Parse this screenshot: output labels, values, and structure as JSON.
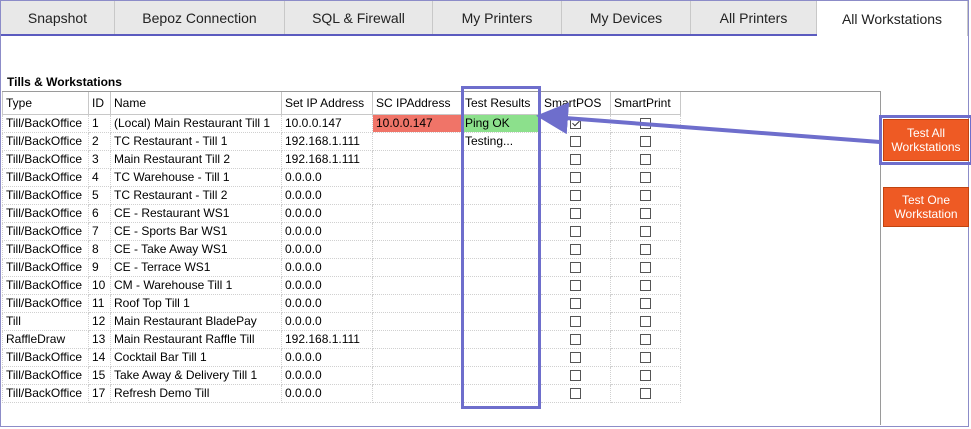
{
  "tabs": [
    {
      "label": "Snapshot",
      "width": 114
    },
    {
      "label": "Bepoz Connection",
      "width": 170
    },
    {
      "label": "SQL & Firewall",
      "width": 148
    },
    {
      "label": "My Printers",
      "width": 129
    },
    {
      "label": "My Devices",
      "width": 129
    },
    {
      "label": "All Printers",
      "width": 126
    },
    {
      "label": "All Workstations",
      "width": 151,
      "active": true
    }
  ],
  "section_title": "Tills & Workstations",
  "columns": [
    "Type",
    "ID",
    "Name",
    "Set IP Address",
    "SC IPAddress",
    "Test Results",
    "SmartPOS",
    "SmartPrint"
  ],
  "rows": [
    {
      "type": "Till/BackOffice",
      "id": "1",
      "name": "(Local) Main Restaurant Till 1",
      "setip": "10.0.0.147",
      "scip": "10.0.0.147",
      "result": "Ping OK",
      "smartpos": true,
      "smartprint": false
    },
    {
      "type": "Till/BackOffice",
      "id": "2",
      "name": "TC Restaurant - Till 1",
      "setip": "192.168.1.111",
      "scip": "",
      "result": "Testing...",
      "smartpos": false,
      "smartprint": false
    },
    {
      "type": "Till/BackOffice",
      "id": "3",
      "name": "Main Restaurant Till 2",
      "setip": "192.168.1.111",
      "scip": "",
      "result": "",
      "smartpos": false,
      "smartprint": false
    },
    {
      "type": "Till/BackOffice",
      "id": "4",
      "name": "TC Warehouse - Till 1",
      "setip": "0.0.0.0",
      "scip": "",
      "result": "",
      "smartpos": false,
      "smartprint": false
    },
    {
      "type": "Till/BackOffice",
      "id": "5",
      "name": "TC Restaurant - Till 2",
      "setip": "0.0.0.0",
      "scip": "",
      "result": "",
      "smartpos": false,
      "smartprint": false
    },
    {
      "type": "Till/BackOffice",
      "id": "6",
      "name": "CE - Restaurant WS1",
      "setip": "0.0.0.0",
      "scip": "",
      "result": "",
      "smartpos": false,
      "smartprint": false
    },
    {
      "type": "Till/BackOffice",
      "id": "7",
      "name": "CE - Sports Bar WS1",
      "setip": "0.0.0.0",
      "scip": "",
      "result": "",
      "smartpos": false,
      "smartprint": false
    },
    {
      "type": "Till/BackOffice",
      "id": "8",
      "name": "CE - Take Away WS1",
      "setip": "0.0.0.0",
      "scip": "",
      "result": "",
      "smartpos": false,
      "smartprint": false
    },
    {
      "type": "Till/BackOffice",
      "id": "9",
      "name": "CE - Terrace WS1",
      "setip": "0.0.0.0",
      "scip": "",
      "result": "",
      "smartpos": false,
      "smartprint": false
    },
    {
      "type": "Till/BackOffice",
      "id": "10",
      "name": "CM - Warehouse Till 1",
      "setip": "0.0.0.0",
      "scip": "",
      "result": "",
      "smartpos": false,
      "smartprint": false
    },
    {
      "type": "Till/BackOffice",
      "id": "11",
      "name": "Roof Top Till 1",
      "setip": "0.0.0.0",
      "scip": "",
      "result": "",
      "smartpos": false,
      "smartprint": false
    },
    {
      "type": "Till",
      "id": "12",
      "name": "Main Restaurant BladePay",
      "setip": "0.0.0.0",
      "scip": "",
      "result": "",
      "smartpos": false,
      "smartprint": false
    },
    {
      "type": "RaffleDraw",
      "id": "13",
      "name": "Main Restaurant Raffle Till",
      "setip": "192.168.1.111",
      "scip": "",
      "result": "",
      "smartpos": false,
      "smartprint": false
    },
    {
      "type": "Till/BackOffice",
      "id": "14",
      "name": "Cocktail Bar Till 1",
      "setip": "0.0.0.0",
      "scip": "",
      "result": "",
      "smartpos": false,
      "smartprint": false
    },
    {
      "type": "Till/BackOffice",
      "id": "15",
      "name": "Take Away & Delivery Till 1",
      "setip": "0.0.0.0",
      "scip": "",
      "result": "",
      "smartpos": false,
      "smartprint": false
    },
    {
      "type": "Till/BackOffice",
      "id": "17",
      "name": "Refresh Demo Till",
      "setip": "0.0.0.0",
      "scip": "",
      "result": "",
      "smartpos": false,
      "smartprint": false
    }
  ],
  "buttons": {
    "test_all_line1": "Test All",
    "test_all_line2": "Workstations",
    "test_one_line1": "Test One",
    "test_one_line2": "Workstation"
  },
  "colors": {
    "accent": "#ee5a24",
    "highlight": "#6e6ecc",
    "ping_ok": "#8ce08c",
    "sc_mismatch": "#f07468"
  }
}
